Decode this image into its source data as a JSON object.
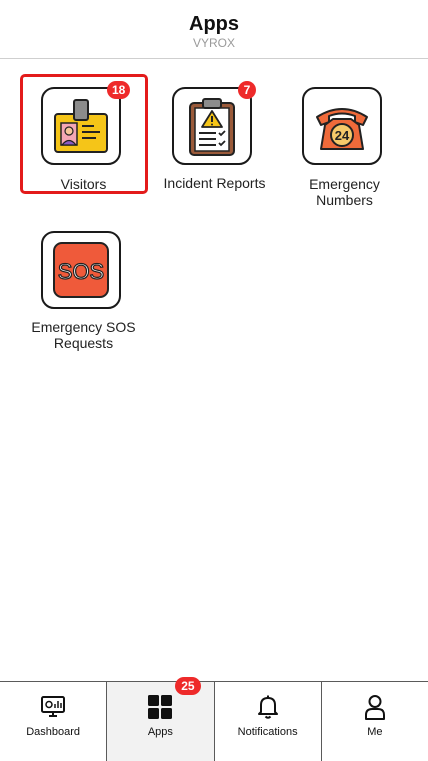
{
  "header": {
    "title": "Apps",
    "subtitle": "VYROX"
  },
  "apps": [
    {
      "label": "Visitors",
      "badge": "18",
      "icon": "id-badge-icon"
    },
    {
      "label": "Incident Reports",
      "badge": "7",
      "icon": "clipboard-warning-icon"
    },
    {
      "label": "Emergency Numbers",
      "badge": "",
      "icon": "phone-24-icon"
    },
    {
      "label": "Emergency SOS Requests",
      "badge": "",
      "icon": "sos-icon"
    }
  ],
  "nav": {
    "dashboard": "Dashboard",
    "apps": "Apps",
    "apps_badge": "25",
    "notifications": "Notifications",
    "me": "Me"
  },
  "colors": {
    "badge": "#ee2a2a",
    "selected_border": "#e31b1b"
  }
}
